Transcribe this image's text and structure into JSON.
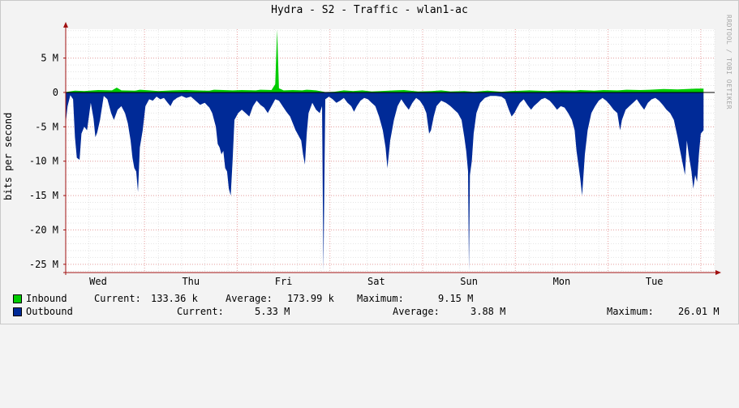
{
  "chart_data": {
    "type": "area",
    "title": "Hydra - S2 - Traffic - wlan1-ac",
    "ylabel": "bits per second",
    "watermark": "RRDTOOL / TOBI OETIKER",
    "yticks": [
      {
        "label": "5 M",
        "value": 5000000
      },
      {
        "label": "0",
        "value": 0
      },
      {
        "label": "-5 M",
        "value": -5000000
      },
      {
        "label": "-10 M",
        "value": -10000000
      },
      {
        "label": "-15 M",
        "value": -15000000
      },
      {
        "label": "-20 M",
        "value": -20000000
      },
      {
        "label": "-25 M",
        "value": -25000000
      }
    ],
    "ylim": [
      -26200000,
      9200000
    ],
    "xlabels": [
      "Wed",
      "Thu",
      "Fri",
      "Sat",
      "Sun",
      "Mon",
      "Tue"
    ],
    "xdays": 7,
    "xstart_offset_days": 0.35,
    "colors": {
      "inbound": "#00cc00",
      "outbound": "#002a97",
      "grid": "#e8a0a0",
      "axis": "#a01010",
      "plot_bg": "#ffffff"
    },
    "series": [
      {
        "name": "Inbound",
        "color": "#00cc00",
        "sign": 1,
        "points": [
          [
            0.0,
            0.05
          ],
          [
            0.1,
            0.25
          ],
          [
            0.2,
            0.2
          ],
          [
            0.3,
            0.3
          ],
          [
            0.35,
            0.35
          ],
          [
            0.5,
            0.3
          ],
          [
            0.55,
            0.7
          ],
          [
            0.6,
            0.3
          ],
          [
            0.75,
            0.25
          ],
          [
            0.8,
            0.4
          ],
          [
            0.9,
            0.3
          ],
          [
            1.0,
            0.2
          ],
          [
            1.15,
            0.3
          ],
          [
            1.3,
            0.35
          ],
          [
            1.4,
            0.3
          ],
          [
            1.55,
            0.25
          ],
          [
            1.6,
            0.4
          ],
          [
            1.8,
            0.3
          ],
          [
            1.9,
            0.35
          ],
          [
            2.05,
            0.3
          ],
          [
            2.1,
            0.4
          ],
          [
            2.22,
            0.35
          ],
          [
            2.26,
            1.2
          ],
          [
            2.28,
            9.15
          ],
          [
            2.3,
            0.6
          ],
          [
            2.35,
            0.3
          ],
          [
            2.45,
            0.35
          ],
          [
            2.55,
            0.3
          ],
          [
            2.6,
            0.4
          ],
          [
            2.7,
            0.3
          ],
          [
            2.8,
            0.05
          ],
          [
            2.9,
            0.1
          ],
          [
            3.0,
            0.3
          ],
          [
            3.1,
            0.2
          ],
          [
            3.2,
            0.3
          ],
          [
            3.3,
            0.15
          ],
          [
            3.4,
            0.2
          ],
          [
            3.55,
            0.3
          ],
          [
            3.65,
            0.35
          ],
          [
            3.8,
            0.15
          ],
          [
            3.95,
            0.2
          ],
          [
            4.05,
            0.3
          ],
          [
            4.15,
            0.15
          ],
          [
            4.3,
            0.2
          ],
          [
            4.4,
            0.1
          ],
          [
            4.55,
            0.25
          ],
          [
            4.7,
            0.1
          ],
          [
            4.8,
            0.2
          ],
          [
            5.0,
            0.3
          ],
          [
            5.2,
            0.2
          ],
          [
            5.35,
            0.3
          ],
          [
            5.5,
            0.25
          ],
          [
            5.55,
            0.35
          ],
          [
            5.7,
            0.25
          ],
          [
            5.8,
            0.35
          ],
          [
            5.95,
            0.3
          ],
          [
            6.05,
            0.4
          ],
          [
            6.2,
            0.35
          ],
          [
            6.3,
            0.4
          ],
          [
            6.45,
            0.5
          ],
          [
            6.6,
            0.45
          ],
          [
            6.7,
            0.5
          ],
          [
            6.8,
            0.55
          ],
          [
            6.88,
            0.55
          ]
        ]
      },
      {
        "name": "Outbound",
        "color": "#002a97",
        "sign": -1,
        "points": [
          [
            0.0,
            -4.5
          ],
          [
            0.02,
            -2.0
          ],
          [
            0.05,
            -0.4
          ],
          [
            0.08,
            -1.0
          ],
          [
            0.1,
            -6.5
          ],
          [
            0.12,
            -9.5
          ],
          [
            0.15,
            -9.8
          ],
          [
            0.17,
            -6.0
          ],
          [
            0.2,
            -5.0
          ],
          [
            0.23,
            -5.5
          ],
          [
            0.27,
            -1.5
          ],
          [
            0.3,
            -3.8
          ],
          [
            0.32,
            -6.5
          ],
          [
            0.34,
            -5.8
          ],
          [
            0.37,
            -4.0
          ],
          [
            0.41,
            -0.5
          ],
          [
            0.45,
            -1.0
          ],
          [
            0.49,
            -3.0
          ],
          [
            0.52,
            -4.0
          ],
          [
            0.56,
            -2.5
          ],
          [
            0.6,
            -2.0
          ],
          [
            0.64,
            -3.0
          ],
          [
            0.67,
            -4.5
          ],
          [
            0.7,
            -7.0
          ],
          [
            0.72,
            -9.5
          ],
          [
            0.74,
            -11.0
          ],
          [
            0.76,
            -11.5
          ],
          [
            0.78,
            -14.5
          ],
          [
            0.8,
            -8.0
          ],
          [
            0.83,
            -5.5
          ],
          [
            0.86,
            -2.0
          ],
          [
            0.9,
            -1.0
          ],
          [
            0.94,
            -1.2
          ],
          [
            0.98,
            -0.6
          ],
          [
            1.02,
            -1.0
          ],
          [
            1.06,
            -0.8
          ],
          [
            1.1,
            -1.5
          ],
          [
            1.13,
            -2.0
          ],
          [
            1.16,
            -1.2
          ],
          [
            1.2,
            -0.8
          ],
          [
            1.25,
            -0.5
          ],
          [
            1.3,
            -0.8
          ],
          [
            1.35,
            -0.6
          ],
          [
            1.4,
            -1.2
          ],
          [
            1.45,
            -1.8
          ],
          [
            1.5,
            -1.5
          ],
          [
            1.55,
            -2.2
          ],
          [
            1.58,
            -3.0
          ],
          [
            1.62,
            -5.0
          ],
          [
            1.64,
            -7.5
          ],
          [
            1.66,
            -8.0
          ],
          [
            1.68,
            -9.0
          ],
          [
            1.7,
            -8.5
          ],
          [
            1.72,
            -11.0
          ],
          [
            1.74,
            -11.5
          ],
          [
            1.76,
            -14.0
          ],
          [
            1.78,
            -15.0
          ],
          [
            1.8,
            -10.0
          ],
          [
            1.82,
            -4.0
          ],
          [
            1.86,
            -3.0
          ],
          [
            1.9,
            -2.5
          ],
          [
            1.94,
            -3.0
          ],
          [
            1.98,
            -3.5
          ],
          [
            2.02,
            -2.0
          ],
          [
            2.06,
            -1.2
          ],
          [
            2.1,
            -1.8
          ],
          [
            2.14,
            -2.2
          ],
          [
            2.18,
            -3.0
          ],
          [
            2.22,
            -2.0
          ],
          [
            2.26,
            -1.0
          ],
          [
            2.3,
            -1.2
          ],
          [
            2.34,
            -2.0
          ],
          [
            2.38,
            -2.8
          ],
          [
            2.42,
            -3.5
          ],
          [
            2.45,
            -4.5
          ],
          [
            2.48,
            -5.5
          ],
          [
            2.5,
            -6.0
          ],
          [
            2.52,
            -6.5
          ],
          [
            2.54,
            -7.0
          ],
          [
            2.56,
            -9.0
          ],
          [
            2.58,
            -10.5
          ],
          [
            2.6,
            -6.0
          ],
          [
            2.62,
            -3.0
          ],
          [
            2.66,
            -1.5
          ],
          [
            2.7,
            -2.5
          ],
          [
            2.74,
            -3.0
          ],
          [
            2.765,
            -2.0
          ],
          [
            2.78,
            -26.0
          ],
          [
            2.8,
            -1.0
          ],
          [
            2.84,
            -0.6
          ],
          [
            2.88,
            -1.0
          ],
          [
            2.92,
            -1.5
          ],
          [
            2.96,
            -1.2
          ],
          [
            3.0,
            -0.8
          ],
          [
            3.04,
            -1.5
          ],
          [
            3.08,
            -2.0
          ],
          [
            3.11,
            -2.8
          ],
          [
            3.14,
            -2.0
          ],
          [
            3.18,
            -1.2
          ],
          [
            3.22,
            -0.8
          ],
          [
            3.26,
            -1.0
          ],
          [
            3.3,
            -1.5
          ],
          [
            3.34,
            -2.0
          ],
          [
            3.38,
            -3.5
          ],
          [
            3.42,
            -5.5
          ],
          [
            3.45,
            -8.0
          ],
          [
            3.47,
            -11.0
          ],
          [
            3.5,
            -7.0
          ],
          [
            3.54,
            -4.0
          ],
          [
            3.58,
            -2.0
          ],
          [
            3.62,
            -1.0
          ],
          [
            3.66,
            -1.8
          ],
          [
            3.7,
            -2.5
          ],
          [
            3.74,
            -1.5
          ],
          [
            3.78,
            -0.8
          ],
          [
            3.82,
            -1.2
          ],
          [
            3.86,
            -2.0
          ],
          [
            3.89,
            -3.0
          ],
          [
            3.92,
            -6.0
          ],
          [
            3.94,
            -5.5
          ],
          [
            3.97,
            -3.5
          ],
          [
            4.0,
            -2.0
          ],
          [
            4.05,
            -1.2
          ],
          [
            4.1,
            -1.5
          ],
          [
            4.15,
            -2.0
          ],
          [
            4.19,
            -2.5
          ],
          [
            4.23,
            -3.0
          ],
          [
            4.27,
            -4.0
          ],
          [
            4.3,
            -6.5
          ],
          [
            4.32,
            -8.5
          ],
          [
            4.34,
            -11.5
          ],
          [
            4.35,
            -26.0
          ],
          [
            4.36,
            -12.0
          ],
          [
            4.38,
            -10.0
          ],
          [
            4.4,
            -6.0
          ],
          [
            4.43,
            -3.0
          ],
          [
            4.47,
            -1.5
          ],
          [
            4.52,
            -0.8
          ],
          [
            4.58,
            -0.5
          ],
          [
            4.64,
            -0.5
          ],
          [
            4.7,
            -0.6
          ],
          [
            4.74,
            -1.0
          ],
          [
            4.78,
            -2.5
          ],
          [
            4.81,
            -3.5
          ],
          [
            4.84,
            -3.0
          ],
          [
            4.87,
            -2.2
          ],
          [
            4.9,
            -1.5
          ],
          [
            4.94,
            -1.0
          ],
          [
            4.98,
            -1.8
          ],
          [
            5.02,
            -2.5
          ],
          [
            5.05,
            -2.0
          ],
          [
            5.09,
            -1.5
          ],
          [
            5.13,
            -1.0
          ],
          [
            5.17,
            -0.8
          ],
          [
            5.22,
            -1.2
          ],
          [
            5.26,
            -1.8
          ],
          [
            5.3,
            -2.5
          ],
          [
            5.34,
            -2.0
          ],
          [
            5.38,
            -2.2
          ],
          [
            5.42,
            -3.0
          ],
          [
            5.46,
            -4.0
          ],
          [
            5.49,
            -5.5
          ],
          [
            5.51,
            -8.5
          ],
          [
            5.53,
            -10.5
          ],
          [
            5.55,
            -12.5
          ],
          [
            5.57,
            -15.0
          ],
          [
            5.6,
            -9.0
          ],
          [
            5.63,
            -5.5
          ],
          [
            5.67,
            -3.0
          ],
          [
            5.71,
            -2.0
          ],
          [
            5.75,
            -1.2
          ],
          [
            5.79,
            -0.8
          ],
          [
            5.83,
            -1.2
          ],
          [
            5.87,
            -1.8
          ],
          [
            5.91,
            -2.5
          ],
          [
            5.95,
            -3.0
          ],
          [
            5.98,
            -5.5
          ],
          [
            6.0,
            -4.0
          ],
          [
            6.04,
            -2.5
          ],
          [
            6.08,
            -2.0
          ],
          [
            6.12,
            -1.5
          ],
          [
            6.16,
            -1.0
          ],
          [
            6.2,
            -1.8
          ],
          [
            6.24,
            -2.5
          ],
          [
            6.28,
            -1.5
          ],
          [
            6.32,
            -1.0
          ],
          [
            6.36,
            -0.8
          ],
          [
            6.4,
            -1.2
          ],
          [
            6.44,
            -1.8
          ],
          [
            6.48,
            -2.5
          ],
          [
            6.52,
            -3.0
          ],
          [
            6.56,
            -4.0
          ],
          [
            6.6,
            -6.5
          ],
          [
            6.62,
            -8.0
          ],
          [
            6.65,
            -10.0
          ],
          [
            6.68,
            -12.0
          ],
          [
            6.7,
            -7.0
          ],
          [
            6.72,
            -9.0
          ],
          [
            6.75,
            -11.5
          ],
          [
            6.77,
            -14.0
          ],
          [
            6.79,
            -12.0
          ],
          [
            6.81,
            -13.0
          ],
          [
            6.83,
            -9.0
          ],
          [
            6.85,
            -6.0
          ],
          [
            6.88,
            -5.5
          ]
        ]
      }
    ]
  },
  "legend": {
    "inbound": {
      "name": "Inbound",
      "current_label": "Current:",
      "current": "133.36 k",
      "average_label": "Average:",
      "average": "173.99 k",
      "maximum_label": "Maximum:",
      "maximum": "9.15 M"
    },
    "outbound": {
      "name": "Outbound",
      "current_label": "Current:",
      "current": "5.33 M",
      "average_label": "Average:",
      "average": "3.88 M",
      "maximum_label": "Maximum:",
      "maximum": "26.01 M"
    }
  }
}
